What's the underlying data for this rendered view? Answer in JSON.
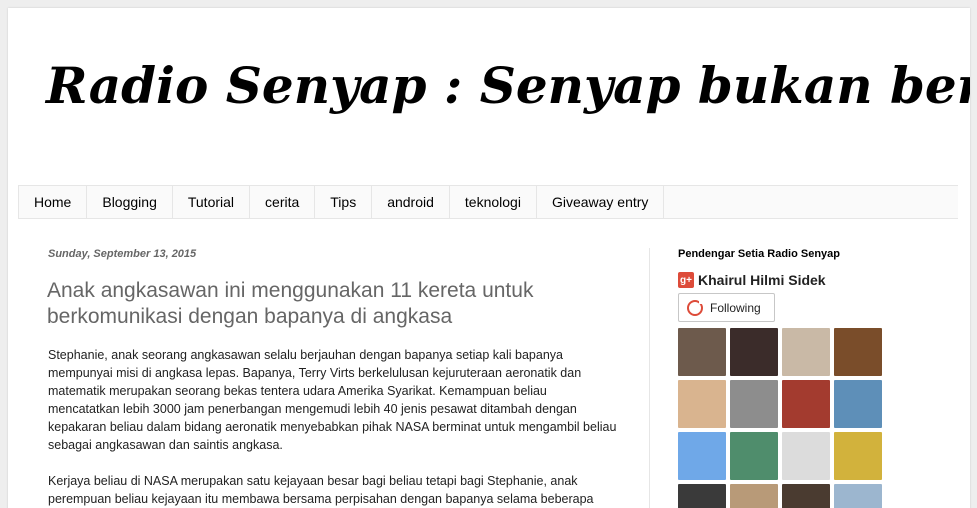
{
  "header": {
    "title": "Radio Senyap : Senyap bukan bererti diam"
  },
  "nav": {
    "tabs": [
      {
        "label": "Home"
      },
      {
        "label": "Blogging"
      },
      {
        "label": "Tutorial"
      },
      {
        "label": "cerita"
      },
      {
        "label": "Tips"
      },
      {
        "label": "android"
      },
      {
        "label": "teknologi"
      },
      {
        "label": "Giveaway entry"
      }
    ]
  },
  "post": {
    "date": "Sunday, September 13, 2015",
    "title": "Anak angkasawan ini menggunakan 11 kereta untuk berkomunikasi dengan bapanya di angkasa",
    "paragraphs": [
      "Stephanie, anak seorang angkasawan selalu berjauhan dengan bapanya setiap kali bapanya mempunyai misi di angkasa lepas. Bapanya, Terry Virts berkelulusan kejuruteraan aeronatik dan matematik merupakan seorang bekas tentera udara Amerika Syarikat. Kemampuan beliau mencatatkan lebih 3000 jam penerbangan mengemudi lebih 40 jenis pesawat ditambah dengan kepakaran beliau dalam bidang aeronatik menyebabkan pihak NASA berminat untuk mengambil beliau sebagai angkasawan dan saintis angkasa.",
      "Kerjaya beliau di NASA merupakan satu kejayaan besar bagi beliau tetapi bagi Stephanie, anak perempuan beliau kejayaan itu membawa bersama perpisahan dengan bapanya selama beberapa"
    ]
  },
  "sidebar": {
    "widget_title": "Pendengar Setia Radio Senyap",
    "gplus_icon": "g+",
    "profile_name": "Khairul Hilmi Sidek",
    "follow_label": "Following",
    "followers": [
      {
        "bg": "#6d5a4c"
      },
      {
        "bg": "#3b2c2a"
      },
      {
        "bg": "#c9b9a6"
      },
      {
        "bg": "#7a4d2a"
      },
      {
        "bg": "#d9b48f"
      },
      {
        "bg": "#8d8d8d"
      },
      {
        "bg": "#a33b2f"
      },
      {
        "bg": "#5e8fb8"
      },
      {
        "bg": "#6fa8e8"
      },
      {
        "bg": "#4f8d6c"
      },
      {
        "bg": "#dcdcdc"
      },
      {
        "bg": "#d2b23c"
      },
      {
        "bg": "#3a3a3a"
      },
      {
        "bg": "#b89a78"
      },
      {
        "bg": "#4a3b30"
      },
      {
        "bg": "#9cb6cf"
      }
    ]
  },
  "colors": {
    "gplus_red": "#dd4b39",
    "post_title": "#666666",
    "background": "#eeeeee"
  }
}
